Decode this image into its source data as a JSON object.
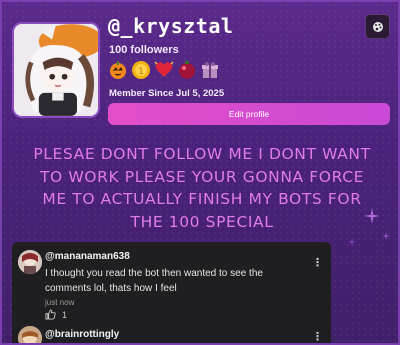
{
  "profile": {
    "username": "@_krysztal",
    "followers": "100 followers",
    "member_since": "Member Since Jul 5, 2025",
    "edit_label": "Edit profile",
    "badges": [
      "pumpkin-badge-icon",
      "coin-badge-icon",
      "heart-badge-icon",
      "ornament-badge-icon",
      "gift-badge-icon"
    ]
  },
  "bio": {
    "lines": [
      "PLESAE DONT FOLLOW ME I DONT WANT",
      "TO WORK PLEASE YOUR GONNA FORCE",
      "ME TO ACTUALLY FINISH MY BOTS FOR",
      "THE 100 SPECIAL"
    ]
  },
  "comments": [
    {
      "author": "@mananaman638",
      "text_lines": [
        "I thought you read the bot then wanted to see the",
        "comments lol, thats how I feel"
      ],
      "time": "just now",
      "likes": "1"
    },
    {
      "author": "@brainrottingly",
      "text_lines": [],
      "time": "",
      "likes": ""
    }
  ],
  "colors": {
    "card_bg": "#4a2278",
    "bio_text": "#e07be8",
    "edit_button": "#e24ec7",
    "comment_bg": "#1f1f22"
  }
}
